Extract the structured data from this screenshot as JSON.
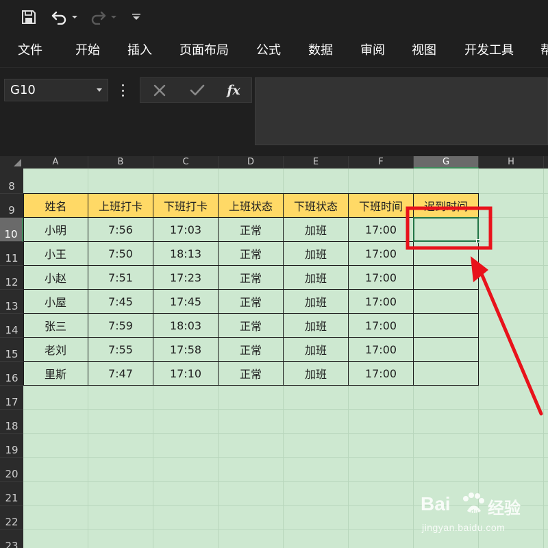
{
  "quick_access": {
    "icons": [
      "save-icon",
      "undo-icon",
      "undo-dropdown-icon",
      "redo-icon",
      "redo-dropdown-icon",
      "customize-toolbar-icon"
    ]
  },
  "ribbon": {
    "tabs": [
      "文件",
      "开始",
      "插入",
      "页面布局",
      "公式",
      "数据",
      "审阅",
      "视图",
      "开发工具",
      "帮"
    ]
  },
  "formula_bar": {
    "name_box": "G10",
    "cancel_icon": "close-icon",
    "enter_icon": "check-icon",
    "function_label": "fx",
    "formula_value": ""
  },
  "sheet": {
    "columns": [
      "A",
      "B",
      "C",
      "D",
      "E",
      "F",
      "G",
      "H"
    ],
    "selected_column": "G",
    "rows": [
      "8",
      "9",
      "10",
      "11",
      "12",
      "13",
      "14",
      "15",
      "16",
      "17",
      "18",
      "19",
      "20",
      "21",
      "22",
      "23"
    ],
    "selected_row": "10",
    "active_cell": "G10",
    "table": {
      "headers": [
        "姓名",
        "上班打卡",
        "下班打卡",
        "上班状态",
        "下班状态",
        "下班时间",
        "迟到时间"
      ],
      "rows": [
        [
          "小明",
          "7:56",
          "17:03",
          "正常",
          "加班",
          "17:00",
          ""
        ],
        [
          "小王",
          "7:50",
          "18:13",
          "正常",
          "加班",
          "17:00",
          ""
        ],
        [
          "小赵",
          "7:51",
          "17:23",
          "正常",
          "加班",
          "17:00",
          ""
        ],
        [
          "小屋",
          "7:45",
          "17:45",
          "正常",
          "加班",
          "17:00",
          ""
        ],
        [
          "张三",
          "7:59",
          "18:03",
          "正常",
          "加班",
          "17:00",
          ""
        ],
        [
          "老刘",
          "7:55",
          "17:58",
          "正常",
          "加班",
          "17:00",
          ""
        ],
        [
          "里斯",
          "7:47",
          "17:10",
          "正常",
          "加班",
          "17:00",
          ""
        ]
      ]
    }
  },
  "colors": {
    "sheet_background": "#cde8d0",
    "header_fill": "#ffd966",
    "annotation": "#e8121b",
    "selection": "#217346"
  },
  "watermark": {
    "logo_text": "Bai",
    "logo_text_2": "经验",
    "url": "jingyan.baidu.com"
  }
}
